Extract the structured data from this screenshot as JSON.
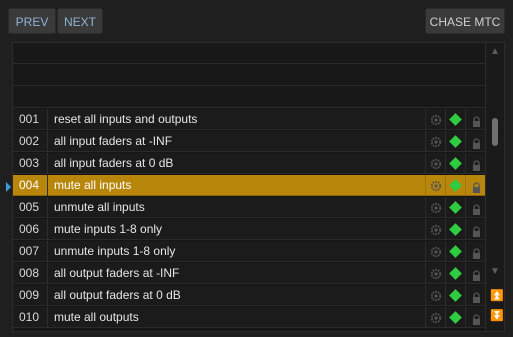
{
  "toolbar": {
    "prev_label": "PREV",
    "next_label": "NEXT",
    "chase_label": "CHASE MTC"
  },
  "colors": {
    "selected": "#b8860b",
    "diamond": "#2ecc40",
    "accent": "#3d9be0"
  },
  "list": {
    "empty_rows": 3,
    "selected_index": 3,
    "items": [
      {
        "num": "001",
        "name": "reset all inputs and outputs"
      },
      {
        "num": "002",
        "name": "all input faders at -INF"
      },
      {
        "num": "003",
        "name": "all input faders at 0 dB"
      },
      {
        "num": "004",
        "name": "mute all inputs"
      },
      {
        "num": "005",
        "name": "unmute all inputs"
      },
      {
        "num": "006",
        "name": "mute inputs 1-8 only"
      },
      {
        "num": "007",
        "name": "unmute inputs 1-8 only"
      },
      {
        "num": "008",
        "name": "all output faders at -INF"
      },
      {
        "num": "009",
        "name": "all output faders at 0 dB"
      },
      {
        "num": "010",
        "name": "mute all outputs"
      }
    ]
  },
  "icons": {
    "row_cells": [
      "cog-icon",
      "diamond-icon",
      "lock-icon"
    ],
    "scroll": [
      "triangle-up-icon",
      "triangle-down-icon",
      "double-up-icon",
      "double-down-icon"
    ]
  }
}
